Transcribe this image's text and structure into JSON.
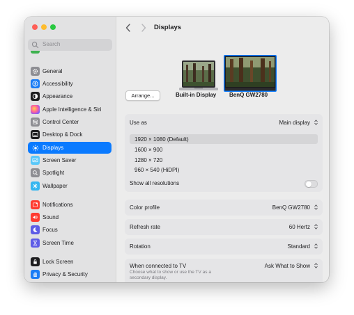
{
  "sidebar": {
    "search_placeholder": "Search",
    "items": [
      {
        "label": "General",
        "icon": "gear-icon",
        "color": "#8e8e93"
      },
      {
        "label": "Accessibility",
        "icon": "accessibility-icon",
        "color": "#1a7cf5"
      },
      {
        "label": "Appearance",
        "icon": "appearance-icon",
        "color": "#1d1d1f"
      },
      {
        "label": "Apple Intelligence & Siri",
        "icon": "siri-icon",
        "color": "#e0559b"
      },
      {
        "label": "Control Center",
        "icon": "control-center-icon",
        "color": "#8e8e93"
      },
      {
        "label": "Desktop & Dock",
        "icon": "dock-icon",
        "color": "#1d1d1f"
      },
      {
        "label": "Displays",
        "icon": "sun-icon",
        "color": "#1a7cf5",
        "selected": true
      },
      {
        "label": "Screen Saver",
        "icon": "screen-saver-icon",
        "color": "#5ac8fa"
      },
      {
        "label": "Spotlight",
        "icon": "spotlight-icon",
        "color": "#8e8e93"
      },
      {
        "label": "Wallpaper",
        "icon": "wallpaper-icon",
        "color": "#35b6f0"
      },
      {
        "label": "Notifications",
        "icon": "notifications-icon",
        "color": "#ff3b30"
      },
      {
        "label": "Sound",
        "icon": "sound-icon",
        "color": "#ff3b30"
      },
      {
        "label": "Focus",
        "icon": "moon-icon",
        "color": "#5e5ce6"
      },
      {
        "label": "Screen Time",
        "icon": "hourglass-icon",
        "color": "#5e5ce6"
      },
      {
        "label": "Lock Screen",
        "icon": "lock-icon",
        "color": "#1d1d1f"
      },
      {
        "label": "Privacy & Security",
        "icon": "hand-icon",
        "color": "#1a7cf5"
      }
    ]
  },
  "header": {
    "title": "Displays"
  },
  "displays": {
    "arrange_label": "Arrange...",
    "builtin_label": "Built-in Display",
    "external_label": "BenQ GW2780"
  },
  "settings": {
    "use_as_label": "Use as",
    "use_as_value": "Main display",
    "resolutions": [
      "1920 × 1080 (Default)",
      "1600 × 900",
      "1280 × 720",
      "960 × 540 (HiDPI)"
    ],
    "selected_resolution_index": 0,
    "show_all_label": "Show all resolutions",
    "show_all_on": false,
    "color_profile_label": "Color profile",
    "color_profile_value": "BenQ GW2780",
    "refresh_rate_label": "Refresh rate",
    "refresh_rate_value": "60 Hertz",
    "rotation_label": "Rotation",
    "rotation_value": "Standard",
    "tv_label": "When connected to TV",
    "tv_value": "Ask What to Show",
    "tv_sub_line1": "Choose what to show or use the TV as a",
    "tv_sub_line2": "secondary display."
  },
  "colors": {
    "accent": "#0a7aff",
    "sidebar_bg": "#e2e2e3",
    "card_bg": "#e5e5e7"
  }
}
